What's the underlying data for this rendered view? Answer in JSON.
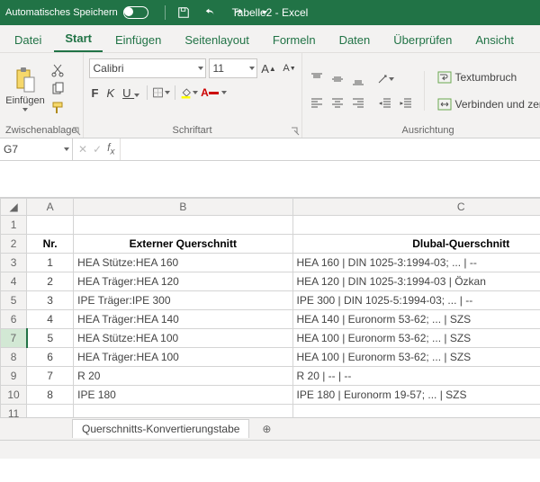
{
  "title_bar": {
    "autosave_label": "Automatisches Speichern",
    "doc_name": "Tabelle2",
    "app_suffix": " - Excel"
  },
  "tabs": {
    "file": "Datei",
    "start": "Start",
    "insert": "Einfügen",
    "layout": "Seitenlayout",
    "formulas": "Formeln",
    "data": "Daten",
    "review": "Überprüfen",
    "view": "Ansicht"
  },
  "ribbon": {
    "clipboard": {
      "paste": "Einfügen",
      "label": "Zwischenablage"
    },
    "font": {
      "name": "Calibri",
      "size": "11",
      "label": "Schriftart"
    },
    "align": {
      "wrap": "Textumbruch",
      "merge": "Verbinden und zen",
      "label": "Ausrichtung"
    }
  },
  "name_box": "G7",
  "sheet_tab": "Querschnitts-Konvertierungstabe",
  "columns": [
    "A",
    "B",
    "C"
  ],
  "headers": {
    "nr": "Nr.",
    "ext": "Externer Querschnitt",
    "dlubal": "Dlubal-Querschnitt"
  },
  "rows": [
    {
      "n": "1",
      "ext": "HEA Stütze:HEA 160",
      "dl": "HEA 160 | DIN 1025-3:1994-03; ... | --"
    },
    {
      "n": "2",
      "ext": "HEA Träger:HEA 120",
      "dl": "HEA 120 | DIN 1025-3:1994-03 | Özkan"
    },
    {
      "n": "3",
      "ext": "IPE Träger:IPE 300",
      "dl": "IPE 300 | DIN 1025-5:1994-03; ... | --"
    },
    {
      "n": "4",
      "ext": "HEA Träger:HEA 140",
      "dl": "HEA 140 | Euronorm 53-62; ... | SZS"
    },
    {
      "n": "5",
      "ext": "HEA Stütze:HEA 100",
      "dl": "HEA 100 | Euronorm 53-62; ... | SZS"
    },
    {
      "n": "6",
      "ext": "HEA Träger:HEA 100",
      "dl": "HEA 100 | Euronorm 53-62; ... | SZS"
    },
    {
      "n": "7",
      "ext": "R 20",
      "dl": "R 20 | -- | --"
    },
    {
      "n": "8",
      "ext": "IPE 180",
      "dl": "IPE 180 | Euronorm 19-57; ... | SZS"
    }
  ],
  "bfi": {
    "B": "F",
    "I": "K",
    "U": "U"
  }
}
